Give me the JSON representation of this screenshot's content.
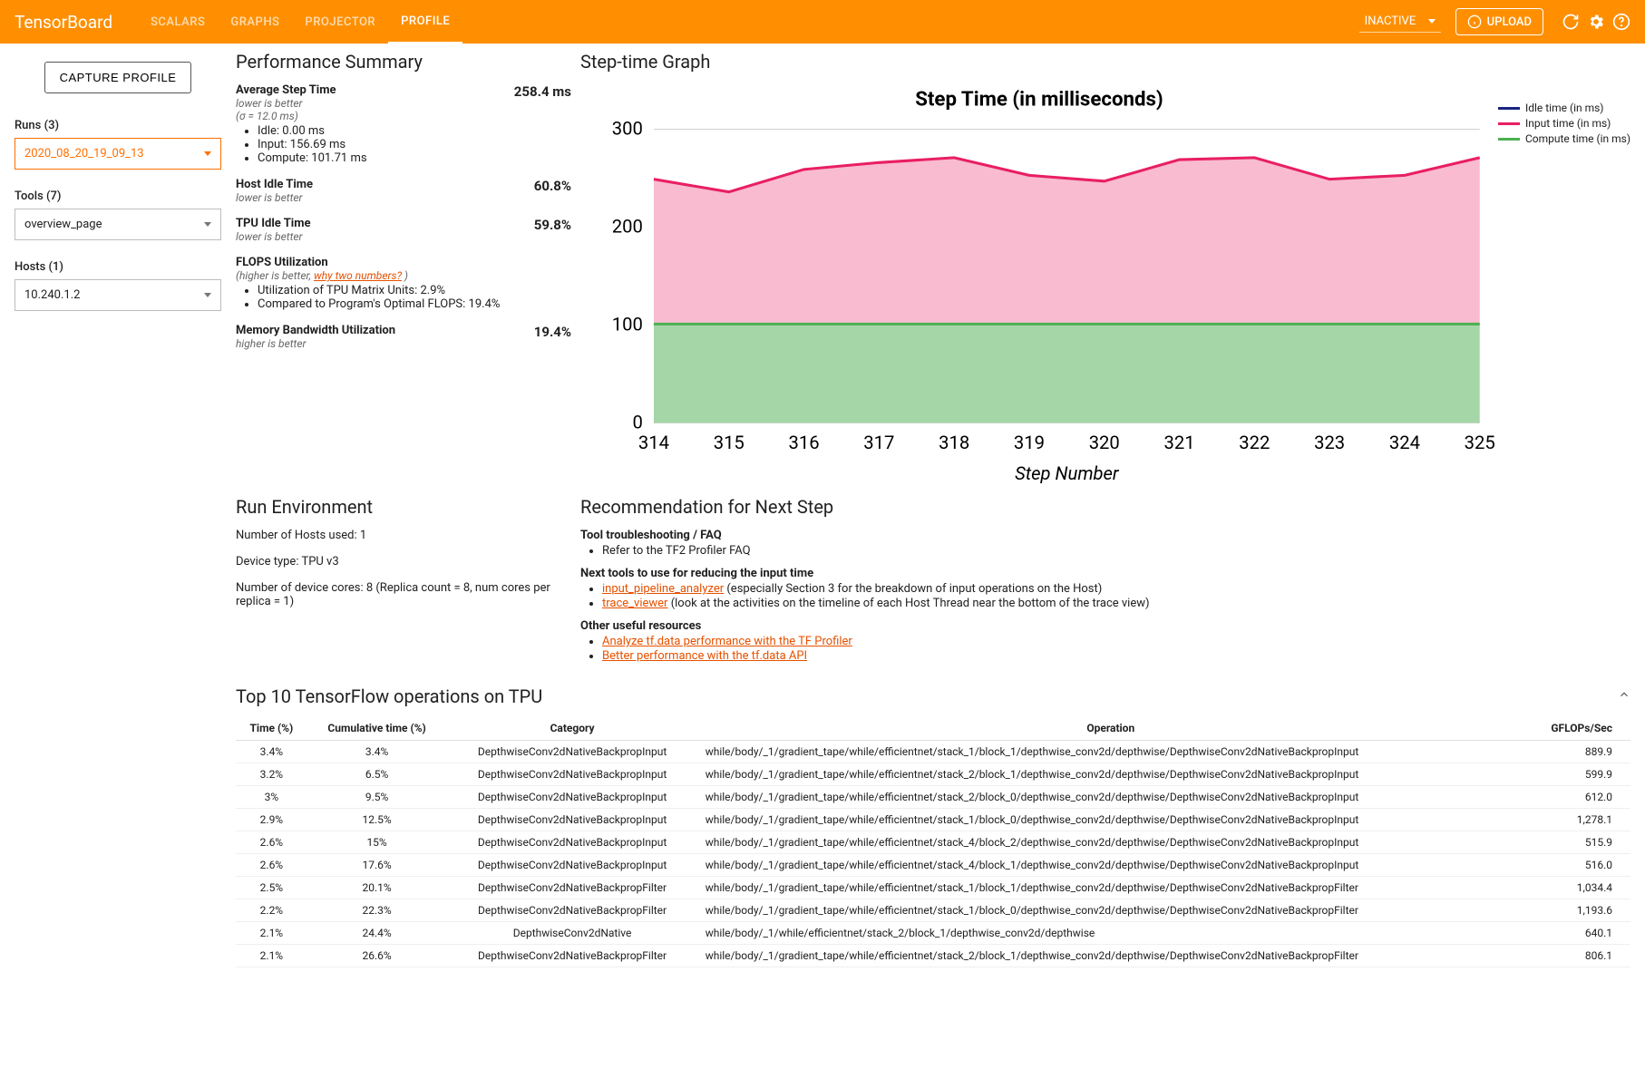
{
  "header": {
    "logo": "TensorBoard",
    "tabs": [
      "SCALARS",
      "GRAPHS",
      "PROJECTOR",
      "PROFILE"
    ],
    "active_tab": "PROFILE",
    "status": "INACTIVE",
    "upload": "UPLOAD"
  },
  "sidebar": {
    "capture": "CAPTURE PROFILE",
    "runs_label": "Runs (3)",
    "runs_value": "2020_08_20_19_09_13",
    "tools_label": "Tools (7)",
    "tools_value": "overview_page",
    "hosts_label": "Hosts (1)",
    "hosts_value": "10.240.1.2"
  },
  "perf": {
    "title": "Performance Summary",
    "avg_step": {
      "title": "Average Step Time",
      "sub": "lower is better",
      "sigma": "(σ = 12.0 ms)",
      "value": "258.4 ms",
      "idle": "Idle: 0.00 ms",
      "input": "Input: 156.69 ms",
      "compute": "Compute: 101.71 ms"
    },
    "host_idle": {
      "title": "Host Idle Time",
      "sub": "lower is better",
      "value": "60.8%"
    },
    "tpu_idle": {
      "title": "TPU Idle Time",
      "sub": "lower is better",
      "value": "59.8%"
    },
    "flops": {
      "title": "FLOPS Utilization",
      "sub_prefix": "(higher is better, ",
      "sub_link": "why two numbers?",
      "sub_suffix": " )",
      "l1": "Utilization of TPU Matrix Units: 2.9%",
      "l2": "Compared to Program's Optimal FLOPS: 19.4%"
    },
    "mem": {
      "title": "Memory Bandwidth Utilization",
      "sub": "higher is better",
      "value": "19.4%"
    }
  },
  "chart": {
    "title": "Step-time Graph",
    "subtitle": "Step Time (in milliseconds)",
    "xlabel": "Step Number",
    "legend": {
      "idle": "Idle time (in ms)",
      "input": "Input time (in ms)",
      "compute": "Compute time (in ms)"
    }
  },
  "chart_data": {
    "type": "area",
    "xlabel": "Step Number",
    "ylabel": "Step Time (in milliseconds)",
    "ylim": [
      0,
      300
    ],
    "yticks": [
      0,
      100,
      200,
      300
    ],
    "x": [
      314,
      315,
      316,
      317,
      318,
      319,
      320,
      321,
      322,
      323,
      324,
      325
    ],
    "series": [
      {
        "name": "Compute time (in ms)",
        "color": "#4caf50",
        "values": [
          101,
          101,
          101,
          101,
          101,
          101,
          101,
          101,
          101,
          101,
          101,
          101
        ]
      },
      {
        "name": "Input time (in ms)",
        "color": "#e91e63",
        "values": [
          148,
          135,
          158,
          165,
          170,
          152,
          146,
          168,
          170,
          148,
          152,
          170
        ]
      },
      {
        "name": "Idle time (in ms)",
        "color": "#1a237e",
        "values": [
          0,
          0,
          0,
          0,
          0,
          0,
          0,
          0,
          0,
          0,
          0,
          0
        ]
      }
    ]
  },
  "rec": {
    "title": "Recommendation for Next Step",
    "s1": "Tool troubleshooting / FAQ",
    "s1_li1": "Refer to the TF2 Profiler FAQ",
    "s2": "Next tools to use for reducing the input time",
    "s2_l1": "input_pipeline_analyzer",
    "s2_t1": " (especially Section 3 for the breakdown of input operations on the Host)",
    "s2_l2": "trace_viewer",
    "s2_t2": " (look at the activities on the timeline of each Host Thread near the bottom of the trace view)",
    "s3": "Other useful resources",
    "s3_l1": "Analyze tf.data performance with the TF Profiler",
    "s3_l2": "Better performance with the tf.data API"
  },
  "env": {
    "title": "Run Environment",
    "hosts": "Number of Hosts used: 1",
    "device": "Device type: TPU v3",
    "cores": "Number of device cores: 8 (Replica count = 8, num cores per replica = 1)"
  },
  "ops": {
    "title": "Top 10 TensorFlow operations on TPU",
    "cols": {
      "time": "Time (%)",
      "cum": "Cumulative time (%)",
      "cat": "Category",
      "op": "Operation",
      "gf": "GFLOPs/Sec"
    },
    "rows": [
      {
        "time": "3.4%",
        "cum": "3.4%",
        "cat": "DepthwiseConv2dNativeBackpropInput",
        "op": "while/body/_1/gradient_tape/while/efficientnet/stack_1/block_1/depthwise_conv2d/depthwise/DepthwiseConv2dNativeBackpropInput",
        "gf": "889.9"
      },
      {
        "time": "3.2%",
        "cum": "6.5%",
        "cat": "DepthwiseConv2dNativeBackpropInput",
        "op": "while/body/_1/gradient_tape/while/efficientnet/stack_2/block_1/depthwise_conv2d/depthwise/DepthwiseConv2dNativeBackpropInput",
        "gf": "599.9"
      },
      {
        "time": "3%",
        "cum": "9.5%",
        "cat": "DepthwiseConv2dNativeBackpropInput",
        "op": "while/body/_1/gradient_tape/while/efficientnet/stack_2/block_0/depthwise_conv2d/depthwise/DepthwiseConv2dNativeBackpropInput",
        "gf": "612.0"
      },
      {
        "time": "2.9%",
        "cum": "12.5%",
        "cat": "DepthwiseConv2dNativeBackpropInput",
        "op": "while/body/_1/gradient_tape/while/efficientnet/stack_1/block_0/depthwise_conv2d/depthwise/DepthwiseConv2dNativeBackpropInput",
        "gf": "1,278.1"
      },
      {
        "time": "2.6%",
        "cum": "15%",
        "cat": "DepthwiseConv2dNativeBackpropInput",
        "op": "while/body/_1/gradient_tape/while/efficientnet/stack_4/block_2/depthwise_conv2d/depthwise/DepthwiseConv2dNativeBackpropInput",
        "gf": "515.9"
      },
      {
        "time": "2.6%",
        "cum": "17.6%",
        "cat": "DepthwiseConv2dNativeBackpropInput",
        "op": "while/body/_1/gradient_tape/while/efficientnet/stack_4/block_1/depthwise_conv2d/depthwise/DepthwiseConv2dNativeBackpropInput",
        "gf": "516.0"
      },
      {
        "time": "2.5%",
        "cum": "20.1%",
        "cat": "DepthwiseConv2dNativeBackpropFilter",
        "op": "while/body/_1/gradient_tape/while/efficientnet/stack_1/block_1/depthwise_conv2d/depthwise/DepthwiseConv2dNativeBackpropFilter",
        "gf": "1,034.4"
      },
      {
        "time": "2.2%",
        "cum": "22.3%",
        "cat": "DepthwiseConv2dNativeBackpropFilter",
        "op": "while/body/_1/gradient_tape/while/efficientnet/stack_1/block_0/depthwise_conv2d/depthwise/DepthwiseConv2dNativeBackpropFilter",
        "gf": "1,193.6"
      },
      {
        "time": "2.1%",
        "cum": "24.4%",
        "cat": "DepthwiseConv2dNative",
        "op": "while/body/_1/while/efficientnet/stack_2/block_1/depthwise_conv2d/depthwise",
        "gf": "640.1"
      },
      {
        "time": "2.1%",
        "cum": "26.6%",
        "cat": "DepthwiseConv2dNativeBackpropFilter",
        "op": "while/body/_1/gradient_tape/while/efficientnet/stack_2/block_1/depthwise_conv2d/depthwise/DepthwiseConv2dNativeBackpropFilter",
        "gf": "806.1"
      }
    ]
  }
}
